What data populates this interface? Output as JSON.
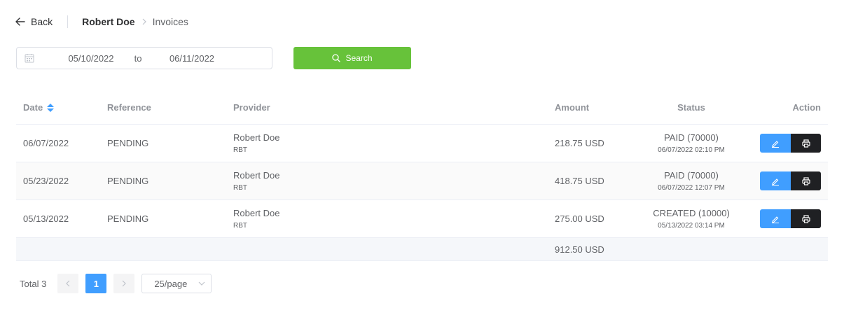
{
  "header": {
    "back_label": "Back",
    "breadcrumb_user": "Robert Doe",
    "breadcrumb_page": "Invoices"
  },
  "filter": {
    "start_date": "05/10/2022",
    "separator": "to",
    "end_date": "06/11/2022",
    "search_label": "Search"
  },
  "table": {
    "columns": {
      "date": "Date",
      "reference": "Reference",
      "provider": "Provider",
      "amount": "Amount",
      "status": "Status",
      "action": "Action"
    },
    "rows": [
      {
        "date": "06/07/2022",
        "reference": "PENDING",
        "provider_name": "Robert Doe",
        "provider_code": "RBT",
        "amount": "218.75 USD",
        "status": "PAID (70000)",
        "status_time": "06/07/2022 02:10 PM"
      },
      {
        "date": "05/23/2022",
        "reference": "PENDING",
        "provider_name": "Robert Doe",
        "provider_code": "RBT",
        "amount": "418.75 USD",
        "status": "PAID (70000)",
        "status_time": "06/07/2022 12:07 PM"
      },
      {
        "date": "05/13/2022",
        "reference": "PENDING",
        "provider_name": "Robert Doe",
        "provider_code": "RBT",
        "amount": "275.00 USD",
        "status": "CREATED (10000)",
        "status_time": "05/13/2022 03:14 PM"
      }
    ],
    "summary_amount": "912.50 USD"
  },
  "pagination": {
    "total_label": "Total 3",
    "current_page": "1",
    "page_size": "25/page"
  },
  "colors": {
    "search_button": "#67c23a",
    "primary": "#409eff",
    "print_button": "#1f2023"
  }
}
